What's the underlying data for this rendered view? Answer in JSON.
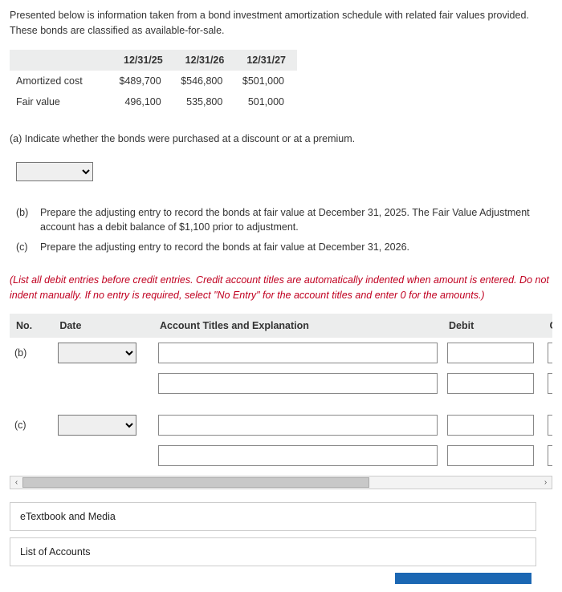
{
  "intro": "Presented below is information taken from a bond investment amortization schedule with related fair values provided. These bonds are classified as available-for-sale.",
  "table": {
    "headers": [
      "12/31/25",
      "12/31/26",
      "12/31/27"
    ],
    "rows": [
      {
        "label": "Amortized cost",
        "c1": "$489,700",
        "c2": "$546,800",
        "c3": "$501,000"
      },
      {
        "label": "Fair value",
        "c1": "496,100",
        "c2": "535,800",
        "c3": "501,000"
      }
    ]
  },
  "part_a": "(a) Indicate whether the bonds were purchased at a discount or at a premium.",
  "b": {
    "lbl": "(b)",
    "txt": "Prepare the adjusting entry to record the bonds at fair value at December 31, 2025. The Fair Value Adjustment account has a debit balance of $1,100 prior to adjustment."
  },
  "c": {
    "lbl": "(c)",
    "txt": "Prepare the adjusting entry to record the bonds at fair value at December 31, 2026."
  },
  "instruction": "(List all debit entries before credit entries. Credit account titles are automatically indented when amount is entered. Do not indent manually. If no entry is required, select \"No Entry\" for the account titles and enter 0 for the amounts.)",
  "je_headers": {
    "no": "No.",
    "date": "Date",
    "acct": "Account Titles and Explanation",
    "debit": "Debit",
    "credit": "Cred"
  },
  "je_rows": {
    "r1_no": "(b)",
    "r3_no": "(c)"
  },
  "links": {
    "etext": "eTextbook and Media",
    "loa": "List of Accounts"
  }
}
